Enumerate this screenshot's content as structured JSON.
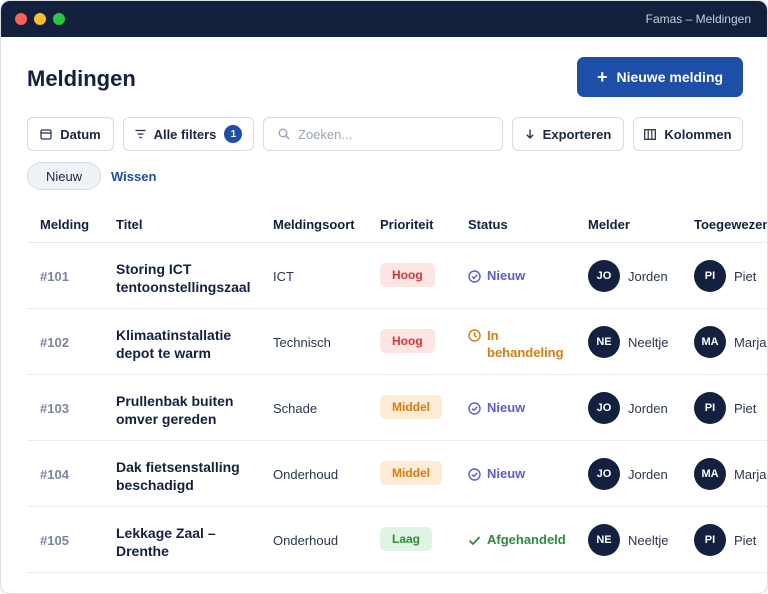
{
  "window": {
    "title": "Famas – Meldingen"
  },
  "header": {
    "title": "Meldingen",
    "new_button_label": "Nieuwe melding",
    "new_button_icon": "plus-icon"
  },
  "toolbar": {
    "date_label": "Datum",
    "filters_label": "Alle filters",
    "filters_count": "1",
    "search_placeholder": "Zoeken...",
    "export_label": "Exporteren",
    "columns_label": "Kolommen"
  },
  "chips": {
    "active_chip": "Nieuw",
    "clear_label": "Wissen"
  },
  "table": {
    "columns": [
      "Melding",
      "Titel",
      "Meldingsoort",
      "Prioriteit",
      "Status",
      "Melder",
      "Toegewezen"
    ],
    "rows": [
      {
        "id": "#101",
        "title": "Storing ICT tentoonstellingszaal",
        "type": "ICT",
        "priority": "Hoog",
        "status": "Nieuw",
        "reporter_initials": "JO",
        "reporter": "Jorden",
        "assignee_initials": "PI",
        "assignee": "Piet"
      },
      {
        "id": "#102",
        "title": "Klimaatinstallatie depot te warm",
        "type": "Technisch",
        "priority": "Hoog",
        "status": "In behandeling",
        "reporter_initials": "NE",
        "reporter": "Neeltje",
        "assignee_initials": "MA",
        "assignee": "Marjan"
      },
      {
        "id": "#103",
        "title": "Prullenbak buiten omver gereden",
        "type": "Schade",
        "priority": "Middel",
        "status": "Nieuw",
        "reporter_initials": "JO",
        "reporter": "Jorden",
        "assignee_initials": "PI",
        "assignee": "Piet"
      },
      {
        "id": "#104",
        "title": "Dak fietsenstalling beschadigd",
        "type": "Onderhoud",
        "priority": "Middel",
        "status": "Nieuw",
        "reporter_initials": "JO",
        "reporter": "Jorden",
        "assignee_initials": "MA",
        "assignee": "Marjan"
      },
      {
        "id": "#105",
        "title": "Lekkage Zaal – Drenthe",
        "type": "Onderhoud",
        "priority": "Laag",
        "status": "Afgehandeld",
        "reporter_initials": "NE",
        "reporter": "Neeltje",
        "assignee_initials": "PI",
        "assignee": "Piet"
      }
    ]
  },
  "colors": {
    "titlebar": "#14213d",
    "primary": "#1d4ea8",
    "priority_high": "#d6343b",
    "priority_medium": "#d97b0f",
    "priority_low": "#2e8b3e",
    "status_new": "#5b5cd6",
    "status_in_progress": "#d97b0f",
    "status_done": "#2e8b3e"
  }
}
